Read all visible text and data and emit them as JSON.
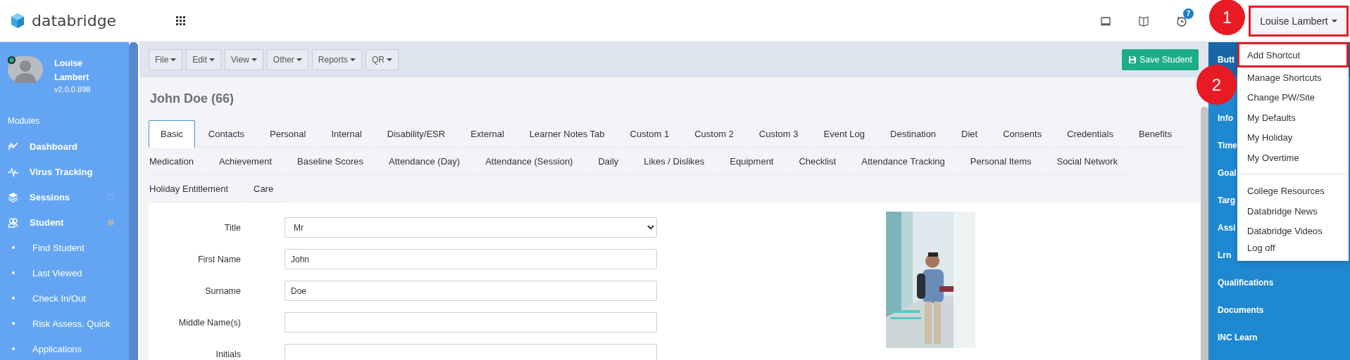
{
  "app": {
    "logo_text": "databridge"
  },
  "header": {
    "notification_count": "7",
    "user_menu": {
      "label": "Louise Lambert",
      "highlighted": true
    }
  },
  "annotations": [
    {
      "label": "1"
    },
    {
      "label": "2"
    }
  ],
  "user_dropdown": {
    "groups": [
      [
        {
          "label": "Add Shortcut",
          "highlighted": true
        },
        {
          "label": "Manage Shortcuts",
          "highlighted": false
        },
        {
          "label": "Change PW/Site",
          "highlighted": false
        },
        {
          "label": "My Defaults",
          "highlighted": false
        },
        {
          "label": "My Holiday",
          "highlighted": false
        },
        {
          "label": "My Overtime",
          "highlighted": false
        }
      ],
      [
        {
          "label": "College Resources",
          "highlighted": false
        },
        {
          "label": "Databridge News",
          "highlighted": false
        },
        {
          "label": "Databridge Videos",
          "highlighted": false
        },
        {
          "label": "Log off",
          "highlighted": false
        }
      ]
    ]
  },
  "sidebar": {
    "user": {
      "name": "Louise Lambert",
      "version": "v2.0.0.898",
      "online": true
    },
    "section": "Modules",
    "items": [
      {
        "kind": "link",
        "label": "Dashboard"
      },
      {
        "kind": "link",
        "label": "Virus Tracking"
      },
      {
        "kind": "group",
        "label": "Sessions",
        "expanded": false
      },
      {
        "kind": "group",
        "label": "Student",
        "expanded": true
      },
      {
        "kind": "subitem",
        "label": "Find Student"
      },
      {
        "kind": "subitem",
        "label": "Last Viewed"
      },
      {
        "kind": "subitem",
        "label": "Check In/Out"
      },
      {
        "kind": "subitem",
        "label": "Risk Assess. Quick"
      },
      {
        "kind": "subitem",
        "label": "Applications"
      }
    ]
  },
  "toolbar": {
    "menus": [
      {
        "label": "File"
      },
      {
        "label": "Edit"
      },
      {
        "label": "View"
      },
      {
        "label": "Other"
      },
      {
        "label": "Reports"
      },
      {
        "label": "QR"
      }
    ],
    "save_button": {
      "label": "Save Student"
    }
  },
  "record_title": "John Doe (66)",
  "tab_rows": [
    [
      {
        "label": "Basic",
        "selected": true
      },
      {
        "label": "Contacts",
        "selected": false
      },
      {
        "label": "Personal",
        "selected": false
      },
      {
        "label": "Internal",
        "selected": false
      },
      {
        "label": "Disability/ESR",
        "selected": false
      },
      {
        "label": "External",
        "selected": false
      },
      {
        "label": "Learner Notes Tab",
        "selected": false
      },
      {
        "label": "Custom 1",
        "selected": false
      },
      {
        "label": "Custom 2",
        "selected": false
      },
      {
        "label": "Custom 3",
        "selected": false
      },
      {
        "label": "Event Log",
        "selected": false
      },
      {
        "label": "Destination",
        "selected": false
      },
      {
        "label": "Diet",
        "selected": false
      },
      {
        "label": "Consents",
        "selected": false
      },
      {
        "label": "Credentials",
        "selected": false
      },
      {
        "label": "Benefits",
        "selected": false
      }
    ],
    [
      {
        "label": "Medication",
        "selected": false
      },
      {
        "label": "Achievement",
        "selected": false
      },
      {
        "label": "Baseline Scores",
        "selected": false
      },
      {
        "label": "Attendance (Day)",
        "selected": false
      },
      {
        "label": "Attendance (Session)",
        "selected": false
      },
      {
        "label": "Daily",
        "selected": false
      },
      {
        "label": "Likes / Dislikes",
        "selected": false
      },
      {
        "label": "Equipment",
        "selected": false
      },
      {
        "label": "Checklist",
        "selected": false
      },
      {
        "label": "Attendance Tracking",
        "selected": false
      },
      {
        "label": "Personal Items",
        "selected": false
      },
      {
        "label": "Social Network",
        "selected": false
      }
    ],
    [
      {
        "label": "Holiday Entitlement",
        "selected": false
      },
      {
        "label": "Care",
        "selected": false
      }
    ]
  ],
  "form_fields": [
    {
      "label": "Title",
      "kind": "select",
      "value": "Mr"
    },
    {
      "label": "First Name",
      "kind": "text",
      "value": "John"
    },
    {
      "label": "Surname",
      "kind": "text",
      "value": "Doe"
    },
    {
      "label": "Middle Name(s)",
      "kind": "text"
    },
    {
      "label": "Initials",
      "kind": "text"
    }
  ],
  "photo": {
    "kind": "picture"
  },
  "right_panel": {
    "items": [
      {
        "label": "Butt",
        "selected": true
      },
      {
        "label": "Info",
        "selected": false
      },
      {
        "label": "Time",
        "selected": false
      },
      {
        "label": "Goal",
        "selected": false
      },
      {
        "label": "Targ",
        "selected": false
      },
      {
        "label": "Assi",
        "selected": false
      },
      {
        "label": "Lrn",
        "selected": false
      },
      {
        "label": "Qualifications",
        "selected": false
      },
      {
        "label": "Documents",
        "selected": false
      },
      {
        "label": "INC Learn",
        "selected": false
      }
    ]
  }
}
